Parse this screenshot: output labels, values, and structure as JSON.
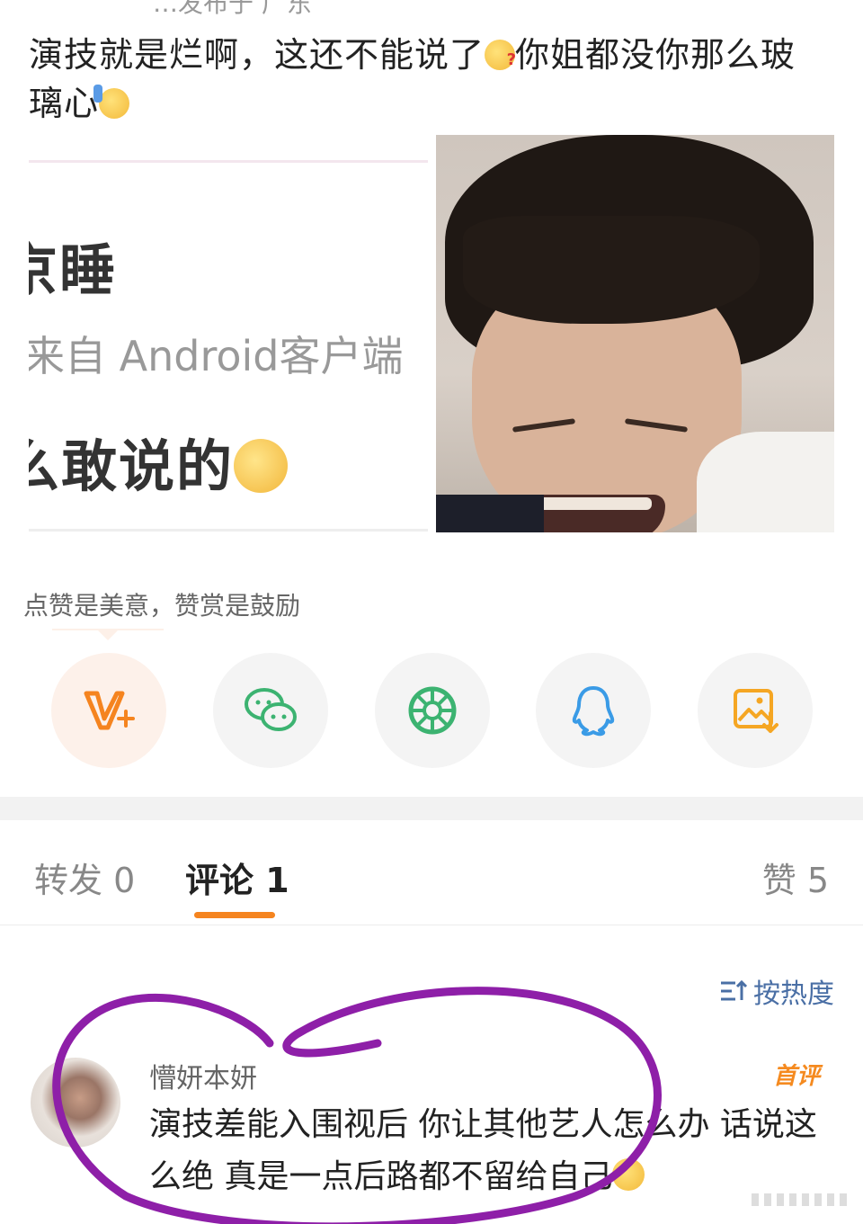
{
  "post": {
    "top_fragment": "…发布于 广东",
    "text": "演技就是烂啊，这还不能说了",
    "text2": "你姐都没你那么玻",
    "text3": "璃心"
  },
  "screenshot_image": {
    "line1": "京睡",
    "line2": "来自 Android客户端",
    "line3": "么敢说的"
  },
  "reward_hint": "点赞是美意，赞赏是鼓励",
  "share": {
    "items": [
      {
        "icon": "reward-v-plus-icon",
        "color": "#f5841f"
      },
      {
        "icon": "wechat-icon",
        "color": "#3cb371"
      },
      {
        "icon": "moments-icon",
        "color": "#3cb371"
      },
      {
        "icon": "qq-icon",
        "color": "#3a9be6"
      },
      {
        "icon": "save-image-icon",
        "color": "#f5a623"
      }
    ]
  },
  "tabs": {
    "repost": "转发 0",
    "comment": "评论 1",
    "like": "赞 5"
  },
  "sort_label": "按热度",
  "comment": {
    "username": "懵妍本妍",
    "badge": "首评",
    "text": "演技差能入围视后 你让其他艺人怎么办 话说这么绝 真是一点后路都不留给自己"
  },
  "colors": {
    "accent": "#f5841f",
    "link": "#4a6fa5",
    "marker": "#8e1fa8"
  }
}
